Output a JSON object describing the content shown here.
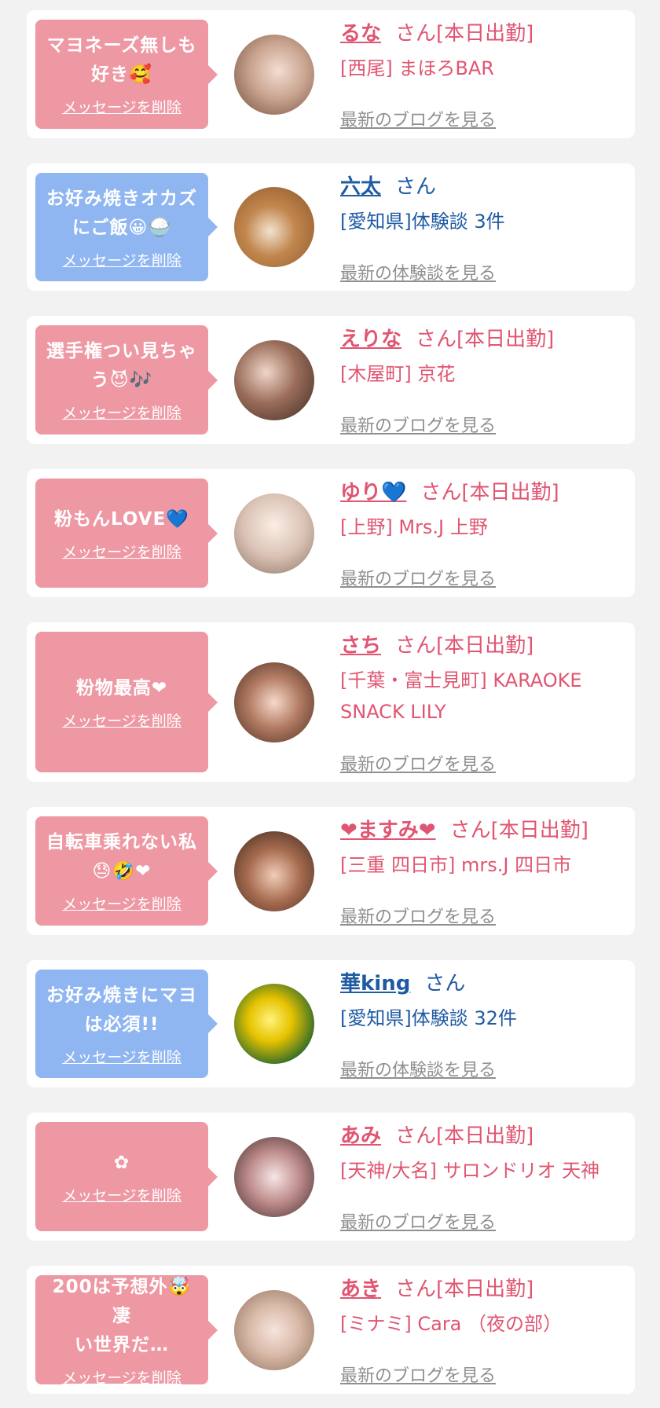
{
  "colors": {
    "page_bg": "#f2f2f2",
    "card_bg": "#ffffff",
    "pink_bubble": "#ee98a4",
    "blue_bubble": "#90b6f2",
    "pink_text": "#e05571",
    "blue_text": "#1f5aa3",
    "link_gray": "#8f8f8f"
  },
  "common": {
    "delete_label": "メッセージを削除",
    "san": "さん",
    "on_duty": "[本日出勤]",
    "blog_link": "最新のブログを見る",
    "review_link": "最新の体験談を見る"
  },
  "cards": [
    {
      "type": "cast",
      "message": "マヨネーズ無しも\n好き🥰",
      "name": "るな",
      "shop": "[西尾] まほろBAR",
      "avatar_icon": "woman-selfie-photo"
    },
    {
      "type": "user",
      "message": "お好み焼きオカズ\nにご飯😀🍚",
      "name": "六太",
      "shop": "[愛知県]体験談 3件",
      "avatar_icon": "food-plate-photo"
    },
    {
      "type": "cast",
      "message": "選手権つい見ちゃ\nう😈🎶",
      "name": "えりな",
      "shop": "[木屋町] 京花",
      "avatar_icon": "woman-with-rose-photo"
    },
    {
      "type": "cast",
      "message": "粉もんLOVE💙",
      "name": "ゆり💙",
      "shop": "[上野] Mrs.J 上野",
      "avatar_icon": "woman-portrait-photo"
    },
    {
      "type": "cast",
      "message": "粉物最高❤",
      "name": "さち",
      "shop": "[千葉・富士見町] KARAOKE\nSNACK LILY",
      "avatar_icon": "woman-selfie-photo"
    },
    {
      "type": "cast",
      "message": "自転車乗れない私\n😓🤣❤",
      "name": "❤ますみ❤",
      "shop": "[三重 四日市] mrs.J 四日市",
      "avatar_icon": "woman-selfie-photo"
    },
    {
      "type": "user",
      "message": "お好み焼きにマヨ\nは必須!!",
      "name": "華king",
      "shop": "[愛知県]体験談 32件",
      "avatar_icon": "yellow-flower-photo"
    },
    {
      "type": "cast",
      "message": "✿",
      "name": "あみ",
      "shop": "[天神/大名] サロンドリオ 天神",
      "avatar_icon": "woman-with-bear-sticker-photo"
    },
    {
      "type": "cast",
      "message": "200は予想外🤯凄\nい世界だ…",
      "name": "あき",
      "shop": "[ミナミ] Cara （夜の部）",
      "avatar_icon": "woman-back-view-photo"
    }
  ]
}
